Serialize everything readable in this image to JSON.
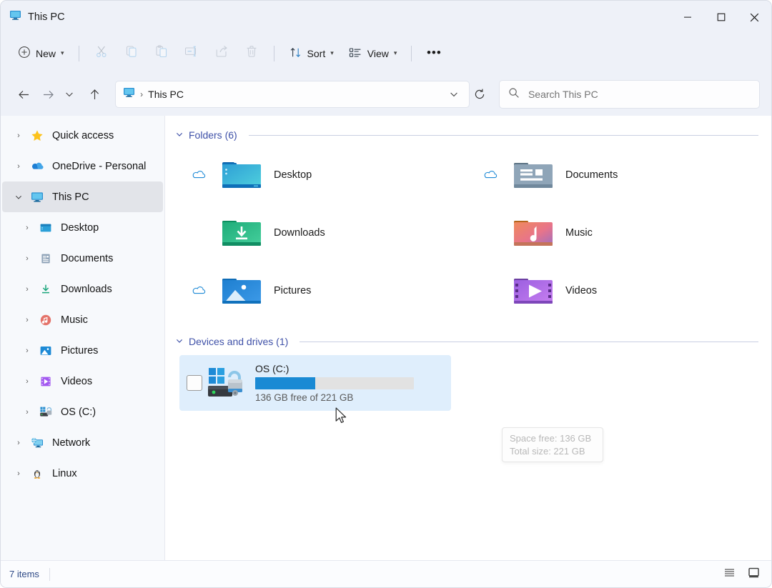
{
  "window": {
    "title": "This PC",
    "title_icon": "monitor-icon",
    "controls": {
      "minimize": "—",
      "maximize": "☐",
      "close": "✕"
    }
  },
  "toolbar": {
    "new_label": "New",
    "new_icon": "plus-circle-icon",
    "actions": [
      {
        "name": "cut",
        "icon": "scissors-icon",
        "disabled": true
      },
      {
        "name": "copy",
        "icon": "copy-icon",
        "disabled": true
      },
      {
        "name": "paste",
        "icon": "clipboard-icon",
        "disabled": true
      },
      {
        "name": "rename",
        "icon": "rename-icon",
        "disabled": true
      },
      {
        "name": "share",
        "icon": "share-icon",
        "disabled": true
      },
      {
        "name": "delete",
        "icon": "trash-icon",
        "disabled": true
      }
    ],
    "sort_label": "Sort",
    "sort_icon": "sort-arrows-icon",
    "view_label": "View",
    "view_icon": "view-list-icon",
    "more_label": "•••"
  },
  "navigation": {
    "back_icon": "arrow-left-icon",
    "forward_icon": "arrow-right-icon",
    "recent_icon": "chevron-down-icon",
    "up_icon": "arrow-up-icon"
  },
  "address": {
    "icon": "monitor-icon",
    "separator": "›",
    "crumb": "This PC",
    "dropdown_icon": "chevron-down-icon",
    "refresh_icon": "refresh-icon"
  },
  "search": {
    "icon": "search-icon",
    "placeholder": "Search This PC",
    "value": ""
  },
  "sidebar": {
    "items": [
      {
        "label": "Quick access",
        "icon": "star-icon",
        "expander": "›",
        "indent": false,
        "selected": false
      },
      {
        "label": "OneDrive - Personal",
        "icon": "cloud-icon",
        "expander": "›",
        "indent": false,
        "selected": false
      },
      {
        "label": "This PC",
        "icon": "monitor-icon",
        "expander": "⌄",
        "indent": false,
        "selected": true
      },
      {
        "label": "Desktop",
        "icon": "desktop-folder-icon",
        "expander": "›",
        "indent": true,
        "selected": false
      },
      {
        "label": "Documents",
        "icon": "documents-folder-icon",
        "expander": "›",
        "indent": true,
        "selected": false
      },
      {
        "label": "Downloads",
        "icon": "downloads-icon",
        "expander": "›",
        "indent": true,
        "selected": false
      },
      {
        "label": "Music",
        "icon": "music-icon",
        "expander": "›",
        "indent": true,
        "selected": false
      },
      {
        "label": "Pictures",
        "icon": "pictures-icon",
        "expander": "›",
        "indent": true,
        "selected": false
      },
      {
        "label": "Videos",
        "icon": "videos-icon",
        "expander": "›",
        "indent": true,
        "selected": false
      },
      {
        "label": "OS (C:)",
        "icon": "drive-icon",
        "expander": "›",
        "indent": true,
        "selected": false
      },
      {
        "label": "Network",
        "icon": "network-icon",
        "expander": "›",
        "indent": false,
        "selected": false
      },
      {
        "label": "Linux",
        "icon": "linux-penguin-icon",
        "expander": "›",
        "indent": false,
        "selected": false
      }
    ]
  },
  "main": {
    "folders_group": {
      "title": "Folders (6)",
      "chevron": "⌄",
      "items": [
        {
          "label": "Desktop",
          "icon": "desktop-folder-icon",
          "cloud": true
        },
        {
          "label": "Documents",
          "icon": "documents-folder-icon",
          "cloud": true
        },
        {
          "label": "Downloads",
          "icon": "downloads-folder-icon",
          "cloud": false
        },
        {
          "label": "Music",
          "icon": "music-folder-icon",
          "cloud": false
        },
        {
          "label": "Pictures",
          "icon": "pictures-folder-icon",
          "cloud": true
        },
        {
          "label": "Videos",
          "icon": "videos-folder-icon",
          "cloud": false
        }
      ]
    },
    "drives_group": {
      "title": "Devices and drives (1)",
      "chevron": "⌄",
      "items": [
        {
          "name": "OS (C:)",
          "icon": "windows-drive-icon",
          "capacity_text": "136 GB free of 221 GB",
          "free_gb": 136,
          "total_gb": 221,
          "used_percent": 38,
          "selected": true,
          "checkbox_checked": false
        }
      ]
    }
  },
  "tooltip": {
    "visible": true,
    "lines": [
      "Space free: 136 GB",
      "Total size: 221 GB"
    ]
  },
  "statusbar": {
    "item_count": "7 items",
    "view_buttons": [
      {
        "name": "details-view",
        "icon": "list-lines-icon"
      },
      {
        "name": "large-icons-view",
        "icon": "monitor-tile-icon"
      }
    ]
  },
  "colors": {
    "accent": "#3f51a8",
    "selection": "#dfeefc",
    "drive_bar": "#1a8ad4",
    "chrome": "#eef1f8"
  }
}
